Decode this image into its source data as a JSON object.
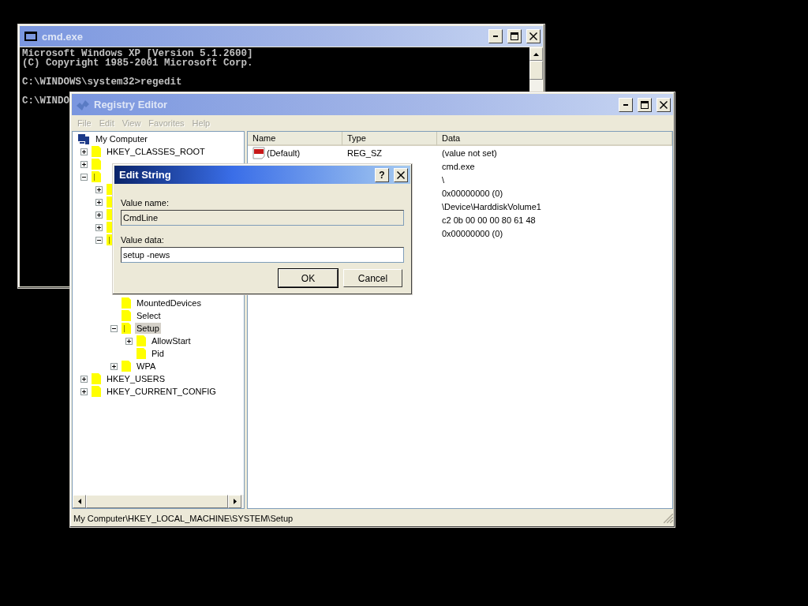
{
  "cmd_window": {
    "title": "cmd.exe",
    "active": false,
    "paragraphs": [
      [
        "Microsoft Windows XP [Version 5.1.2600]",
        "(C) Copyright 1985-2001 Microsoft Corp."
      ],
      [
        "C:\\WINDOWS\\system32>regedit"
      ],
      [
        "C:\\WINDO"
      ]
    ]
  },
  "registry_editor": {
    "title": "Registry Editor",
    "active": false,
    "menu": [
      {
        "label": "File",
        "disabled": true
      },
      {
        "label": "Edit",
        "disabled": true
      },
      {
        "label": "View",
        "disabled": true
      },
      {
        "label": "Favorites",
        "disabled": true
      },
      {
        "label": "Help",
        "disabled": true
      }
    ],
    "tree": {
      "label": "My Computer",
      "kind": "computer",
      "children": [
        {
          "kind": "key",
          "label": "HKEY_CLASSES_ROOT",
          "expandable": true,
          "expanded": false
        },
        {
          "kind": "key",
          "expandable": true,
          "expanded": false
        },
        {
          "kind": "key",
          "expandable": true,
          "expanded": true,
          "children": [
            {
              "kind": "key",
              "expandable": true,
              "expanded": false
            },
            {
              "kind": "key",
              "expandable": true,
              "expanded": false
            },
            {
              "kind": "key",
              "expandable": true,
              "expanded": false
            },
            {
              "kind": "key",
              "expandable": true,
              "expanded": false
            },
            {
              "kind": "key",
              "expandable": true,
              "expanded": true,
              "children": [
                {
                  "kind": "covered"
                },
                {
                  "kind": "covered"
                },
                {
                  "kind": "covered"
                },
                {
                  "kind": "covered"
                },
                {
                  "kind": "key",
                  "label": "MountedDevices"
                },
                {
                  "kind": "key",
                  "label": "Select"
                },
                {
                  "kind": "key",
                  "label": "Setup",
                  "expandable": true,
                  "expanded": true,
                  "selected": true,
                  "children": [
                    {
                      "kind": "key",
                      "label": "AllowStart",
                      "expandable": true,
                      "expanded": false
                    },
                    {
                      "kind": "key",
                      "label": "Pid"
                    }
                  ]
                },
                {
                  "kind": "key",
                  "label": "WPA",
                  "expandable": true,
                  "expanded": false
                }
              ]
            }
          ]
        },
        {
          "kind": "key",
          "label": "HKEY_USERS",
          "expandable": true,
          "expanded": false
        },
        {
          "kind": "key",
          "label": "HKEY_CURRENT_CONFIG",
          "expandable": true,
          "expanded": false
        }
      ]
    },
    "list": {
      "columns": [
        "Name",
        "Type",
        "Data"
      ],
      "rows": [
        {
          "name": "(Default)",
          "type": "REG_SZ",
          "data": "(value not set)"
        },
        {
          "data": "cmd.exe"
        },
        {
          "data": "\\"
        },
        {
          "data": "0x00000000 (0)"
        },
        {
          "data": "\\Device\\HarddiskVolume1"
        },
        {
          "data": "c2 0b 00 00 00 80 61 48"
        },
        {
          "data": "0x00000000 (0)"
        }
      ]
    },
    "status_bar": "My Computer\\HKEY_LOCAL_MACHINE\\SYSTEM\\Setup"
  },
  "edit_string_dialog": {
    "title": "Edit String",
    "active": true,
    "help_button": "?",
    "value_name_label": "Value name:",
    "value_name": "CmdLine",
    "value_data_label": "Value data:",
    "value_data": "setup -news",
    "buttons": [
      {
        "label": "OK",
        "default": true
      },
      {
        "label": "Cancel",
        "default": false
      }
    ]
  }
}
